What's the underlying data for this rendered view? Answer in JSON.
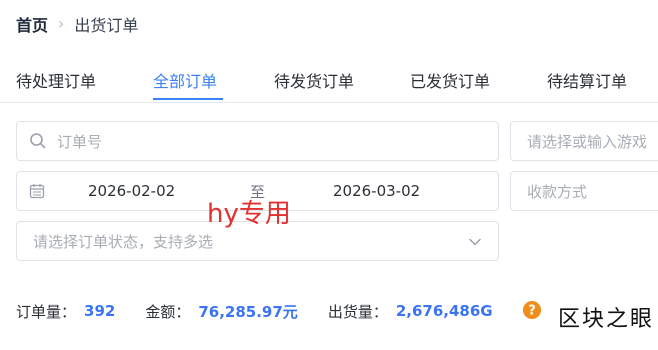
{
  "breadcrumb": {
    "home": "首页",
    "separator": "›",
    "current": "出货订单"
  },
  "tabs": [
    {
      "label": "待处理订单",
      "active": false
    },
    {
      "label": "全部订单",
      "active": true
    },
    {
      "label": "待发货订单",
      "active": false
    },
    {
      "label": "已发货订单",
      "active": false
    },
    {
      "label": "待结算订单",
      "active": false
    }
  ],
  "filters": {
    "order_no_placeholder": "订单号",
    "game_placeholder": "请选择或输入游戏",
    "date_start": "2026-02-02",
    "date_separator": "至",
    "date_end": "2026-03-02",
    "payment_placeholder": "收款方式",
    "status_placeholder": "请选择订单状态，支持多选"
  },
  "overlay_text": "hy专用",
  "summary": {
    "order_count_label": "订单量：",
    "order_count": "392",
    "amount_label": "金额：",
    "amount": "76,285.97元",
    "shipped_label": "出货量：",
    "shipped": "2,676,486G"
  },
  "corner_text": "区块之眼",
  "colors": {
    "accent": "#3b82f6",
    "value": "#3b74f2",
    "help": "#f08c1a",
    "overlay": "#e03232"
  }
}
